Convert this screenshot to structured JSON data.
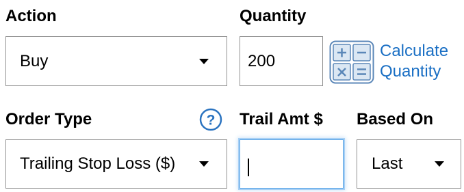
{
  "action": {
    "label": "Action",
    "value": "Buy"
  },
  "quantity": {
    "label": "Quantity",
    "value": "200",
    "calc_link_line1": "Calculate",
    "calc_link_line2": "Quantity"
  },
  "order_type": {
    "label": "Order Type",
    "value": "Trailing Stop Loss ($)",
    "help_glyph": "?"
  },
  "trail_amt": {
    "label": "Trail Amt $",
    "value": ""
  },
  "based_on": {
    "label": "Based On",
    "value": "Last"
  },
  "colors": {
    "link": "#1a6fc4",
    "focus_ring": "#5aa4e6",
    "border": "#8f8f8f"
  }
}
